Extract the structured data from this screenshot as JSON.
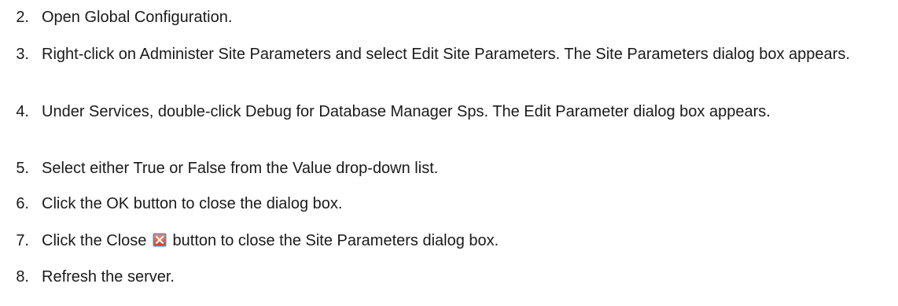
{
  "steps": [
    {
      "number": "2.",
      "text": "Open Global Configuration."
    },
    {
      "number": "3.",
      "text": "Right-click on Administer Site Parameters and select Edit Site Parameters. The Site Parameters dialog box appears."
    },
    {
      "number": "4.",
      "text": "Under Services, double-click Debug for Database Manager Sps. The Edit Parameter dialog box appears."
    },
    {
      "number": "5.",
      "text": "Select either True or False from the Value drop-down list."
    },
    {
      "number": "6.",
      "text": "Click the OK button to close the dialog box."
    },
    {
      "number": "7.",
      "text_before": "Click the Close",
      "text_after": "button to close the Site Parameters dialog box.",
      "icon": "close-icon"
    },
    {
      "number": "8.",
      "text": "Refresh the server."
    }
  ],
  "colors": {
    "text": "#1a1a1a",
    "close_icon_fill": "#e8532f",
    "close_icon_border": "#5f86c9"
  }
}
